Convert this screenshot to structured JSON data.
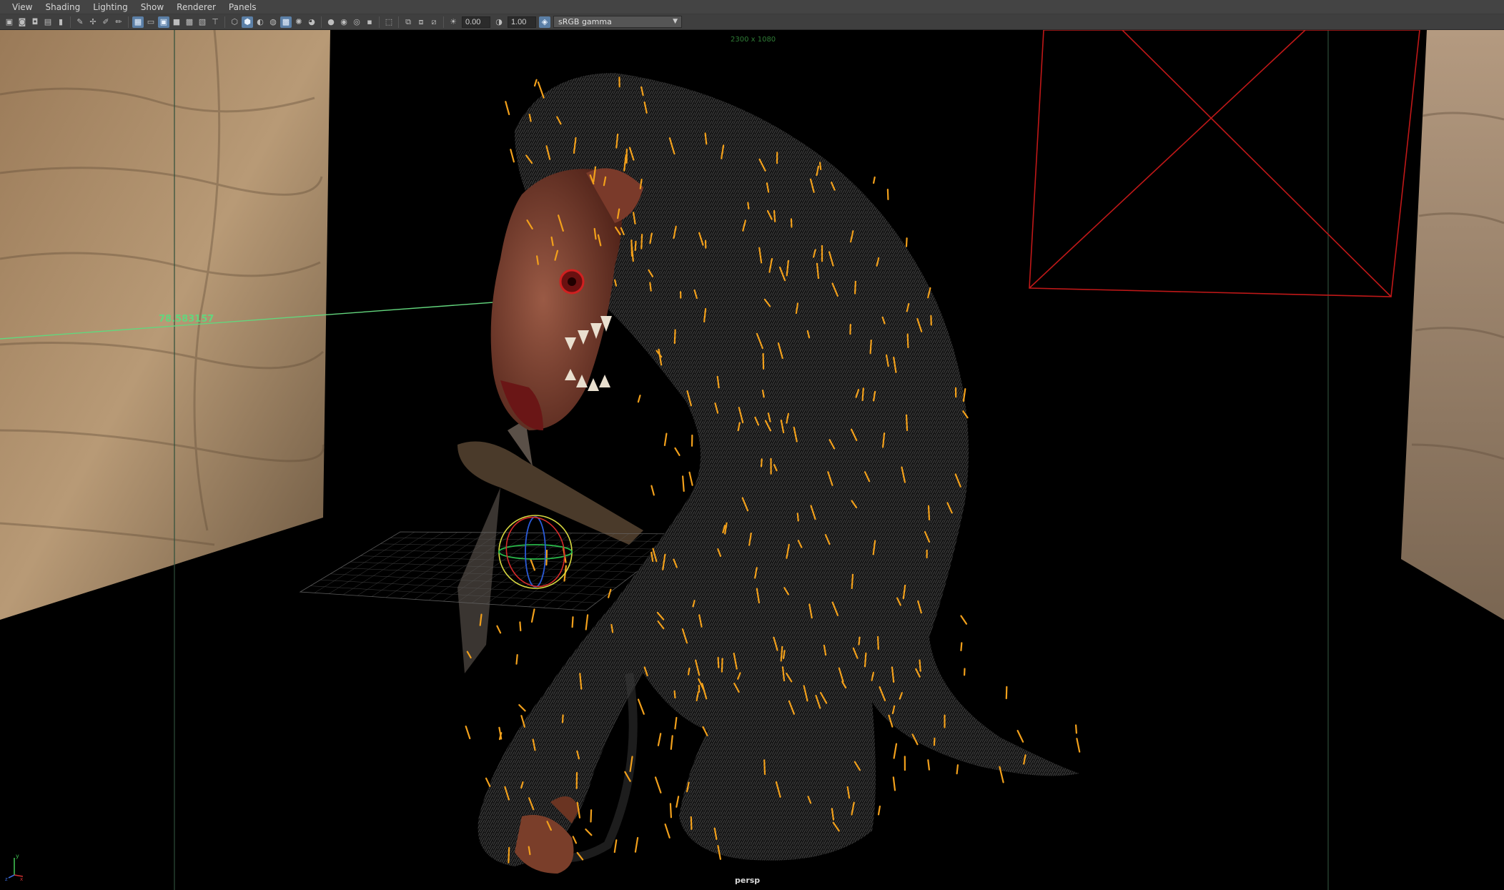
{
  "menubar": {
    "items": [
      "View",
      "Shading",
      "Lighting",
      "Show",
      "Renderer",
      "Panels"
    ]
  },
  "toolbar": {
    "icons": [
      "select-camera-icon",
      "camera-attributes-icon",
      "bookmark-icon",
      "image-plane-icon",
      "2d-pan-zoom-icon",
      "grease-pencil-icon",
      "grid-icon",
      "film-gate-icon",
      "resolution-gate-icon",
      "gate-mask-icon",
      "field-chart-icon",
      "safe-action-icon",
      "safe-title-icon",
      "wireframe-icon",
      "smooth-shade-icon",
      "default-lighting-icon",
      "shadows-icon",
      "textured-icon",
      "ambient-occlusion-icon",
      "motion-blur-icon",
      "anti-aliasing-icon",
      "depth-of-field-icon",
      "isolate-select-icon",
      "xray-icon",
      "xray-joints-icon",
      "backface-culling-icon",
      "exposure-icon",
      "gamma-icon"
    ],
    "exposure_value": "0.00",
    "gamma_value": "1.00",
    "color_space": "sRGB gamma"
  },
  "viewport": {
    "resolution_text": "2300 x 1080",
    "camera_name": "persp",
    "measure_text": "78.583157",
    "axis_labels": [
      "y",
      "x",
      "z"
    ]
  },
  "colors": {
    "menubar_bg": "#444444",
    "toolbar_bg": "#3f3f3f",
    "viewport_bg": "#000000",
    "hair_guide": "#f2a01b",
    "measure_line": "#63d67d",
    "camera_frustum": "#c01818"
  }
}
